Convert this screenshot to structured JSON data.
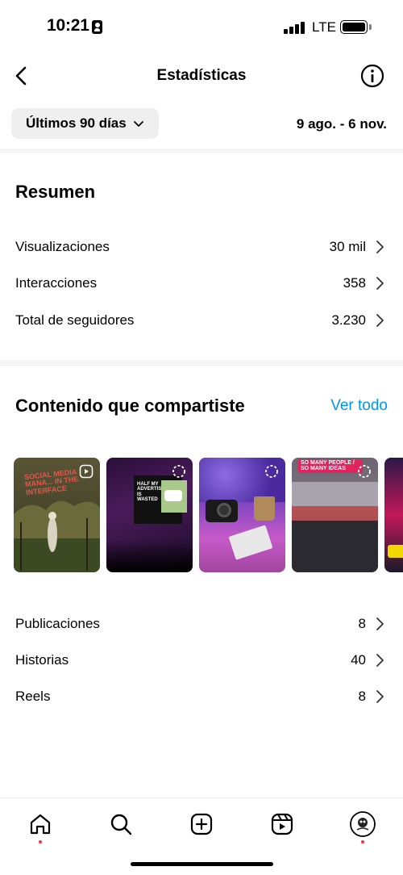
{
  "status_bar": {
    "time": "10:21",
    "network": "LTE"
  },
  "header": {
    "title": "Estadísticas"
  },
  "filter": {
    "range_label": "Últimos 90 días",
    "date_range": "9 ago. - 6 nov."
  },
  "summary": {
    "title": "Resumen",
    "rows": [
      {
        "label": "Visualizaciones",
        "value": "30 mil"
      },
      {
        "label": "Interacciones",
        "value": "358"
      },
      {
        "label": "Total de seguidores",
        "value": "3.230"
      }
    ]
  },
  "content": {
    "title": "Contenido que compartiste",
    "see_all": "Ver todo",
    "thumbnails": [
      {
        "type": "reel",
        "caption": "Social media mana... in the interface"
      },
      {
        "type": "story",
        "caption": "Half my advertising is wasted"
      },
      {
        "type": "story",
        "caption": ""
      },
      {
        "type": "story",
        "caption": "So many people / so many ideas"
      },
      {
        "type": "story",
        "caption": ""
      }
    ],
    "rows": [
      {
        "label": "Publicaciones",
        "value": "8"
      },
      {
        "label": "Historias",
        "value": "40"
      },
      {
        "label": "Reels",
        "value": "8"
      }
    ]
  },
  "bottom_nav": {
    "items": [
      "home-icon",
      "search-icon",
      "create-icon",
      "reels-icon",
      "profile-icon"
    ]
  },
  "colors": {
    "accent": "#0095f6",
    "notification": "#ff3040"
  }
}
